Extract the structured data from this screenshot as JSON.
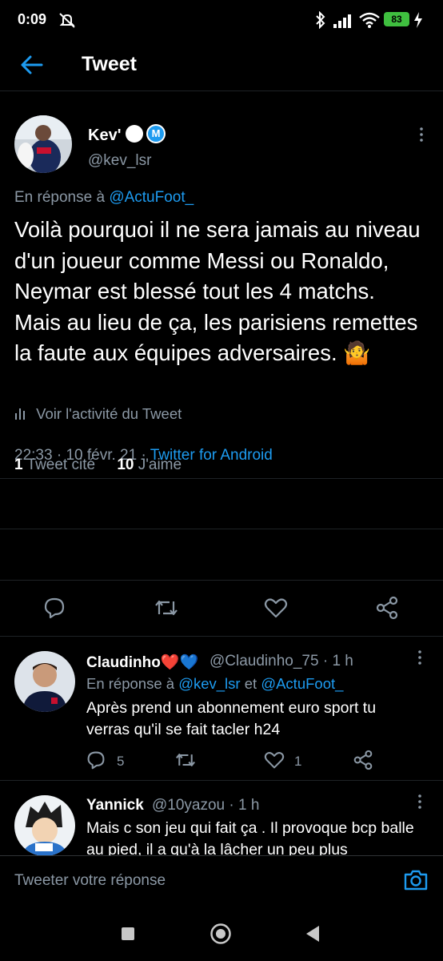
{
  "status_bar": {
    "time": "0:09",
    "battery": "83"
  },
  "header": {
    "title": "Tweet"
  },
  "tweet": {
    "author_name": "Kev'",
    "verified_badge": "M",
    "author_handle": "@kev_lsr",
    "reply_prefix": "En réponse à",
    "reply_to": "@ActuFoot_",
    "text": "Voilà pourquoi il ne sera jamais au niveau d'un joueur comme Messi ou Ronaldo,\nNeymar est blessé tout les 4 matchs.\nMais au lieu de ça, les parisiens remettes la faute aux équipes adversaires. 🤷",
    "time": "22:33",
    "date": "10 févr. 21",
    "separator": "·",
    "source": "Twitter for Android",
    "activity_label": "Voir l'activité du Tweet",
    "quote_count": "1",
    "quote_label": "Tweet cité",
    "like_count": "10",
    "like_label": "J'aime"
  },
  "replies": [
    {
      "name": "Claudinho❤️💙",
      "handle": "@Claudinho_75 · 1 h",
      "reply_prefix": "En réponse à",
      "reply_to_1": "@kev_lsr",
      "reply_and": "et",
      "reply_to_2": "@ActuFoot_",
      "text": "Après prend un abonnement euro sport tu verras qu'il se fait tacler h24",
      "reply_count": "5",
      "like_count": "1"
    },
    {
      "name": "Yannick",
      "handle": "@10yazou · 1 h",
      "text": "Mais c son jeu qui fait ça . Il provoque bcp balle au pied, il a qu'à la lâcher un peu plus"
    }
  ],
  "composer": {
    "placeholder": "Tweeter votre réponse"
  },
  "colors": {
    "accent": "#1d9bf0",
    "muted": "#8b98a5",
    "background": "#000000"
  }
}
